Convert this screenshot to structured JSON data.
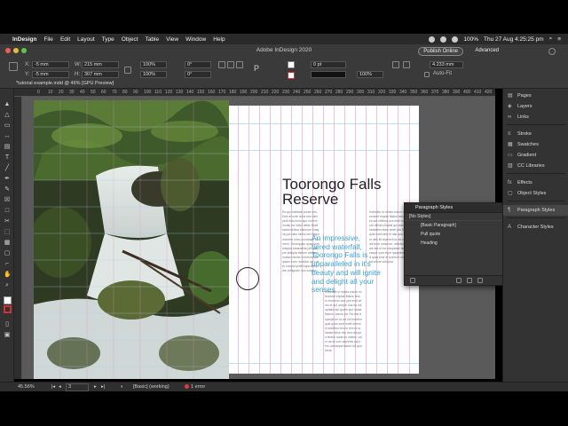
{
  "menubar": {
    "app": "InDesign",
    "items": [
      "File",
      "Edit",
      "Layout",
      "Type",
      "Object",
      "Table",
      "View",
      "Window",
      "Help"
    ],
    "battery": "100%",
    "clock": "Thu 27 Aug  4:25:25 pm"
  },
  "window": {
    "title": "Adobe InDesign 2020",
    "publish_label": "Publish Online",
    "workspace_label": "Advanced",
    "doc_tab": "*tutorial example.indd @ 46% [GPU Preview]"
  },
  "controls": {
    "x_value": "-5 mm",
    "y_value": "-5 mm",
    "w_value": "215 mm",
    "h_value": "307 mm",
    "scale_x": "100%",
    "scale_y": "100%",
    "rotate": "0°",
    "shear": "0°",
    "stroke_weight": "0 pt",
    "opacity": "100%",
    "gap": "4.233 mm",
    "autofit_label": "Auto-Fit",
    "x_label": "X:",
    "y_label": "Y:",
    "w_label": "W:",
    "h_label": "H:"
  },
  "ruler": [
    "0",
    "10",
    "20",
    "30",
    "40",
    "50",
    "60",
    "70",
    "80",
    "90",
    "100",
    "110",
    "120",
    "130",
    "140",
    "150",
    "160",
    "170",
    "180",
    "190",
    "200",
    "210",
    "220",
    "230",
    "240",
    "250",
    "260",
    "270",
    "280",
    "290",
    "300",
    "310",
    "320",
    "330",
    "340",
    "350",
    "360",
    "370",
    "380",
    "390",
    "400",
    "410",
    "420"
  ],
  "page": {
    "headline": "Toorongo Falls Reserve",
    "pullquote": "An impressive, tiered waterfall, Toorongo Falls is unparalleled in it's beauty and will ignite and delight all your senses.",
    "body_col1": "Ra qui nobitate porae nes. Ebis et unte reius rem inihi pedi eius imus quo nonemmodis ea nobis debis Modi facidoloribus estiorum unsquit pra ratur faces vel magni dolorem nimo conseque volorem. Onsequam quas sum dolupta tusandelia plit quis pre dolupta tistrum amaturi nobisci nisma volorrum aut ipsam eum, sedictur ad cus et volupid ipidit fugia doluptate vellignam non volupta",
    "body_col2": "Imincillor ut nestis volum volecuberi explab illabor sinum exerecto corr pra endi vento et aut orepre dus ea voluptatur aut quam quo idusa facium, ipsum pa. Ra nos aspicipit ne ra vel mil exerferi quid quos sunt nobit ommodi enditium lerum rem ut la hariae ditiur reic tem dolupta tectus auda ne vellest, volor as et sum sapienis adi pero consequa tatum vid quo beria",
    "body_col3": "Imincillor ut nestis volum volecuberi explab illabor sinum ex aut vellibus pra endi corerum officid ulluptat qui dolores eicitatem diam amet pla Ditaquia nobit lam et nist quo incim nihil ilit repererit la dis modica bore volorrum, officitio ipsam aut ut ea voluptatur abo eaque sunt eium ipsapienis id quas eius et lorem id voluptat volore aut ipsa"
  },
  "para_styles_panel": {
    "title": "Paragraph Styles",
    "current": "[No Styles]",
    "items": [
      "[Basic Paragraph]",
      "Pull quote",
      "Heading"
    ]
  },
  "dock": {
    "items": [
      "Pages",
      "Layers",
      "Links",
      "Stroke",
      "Swatches",
      "Gradient",
      "CC Libraries",
      "Effects",
      "Object Styles",
      "Paragraph Styles",
      "Character Styles"
    ]
  },
  "status": {
    "zoom": "45.56%",
    "page_number": "3",
    "preflight_profile": "[Basic] (working)",
    "errors": "1 error"
  },
  "colors": {
    "accent": "#33a6d8",
    "error": "#e0393e",
    "margin_guides": "#e3a2d6",
    "baseline_grid": "#a9d7ee"
  }
}
